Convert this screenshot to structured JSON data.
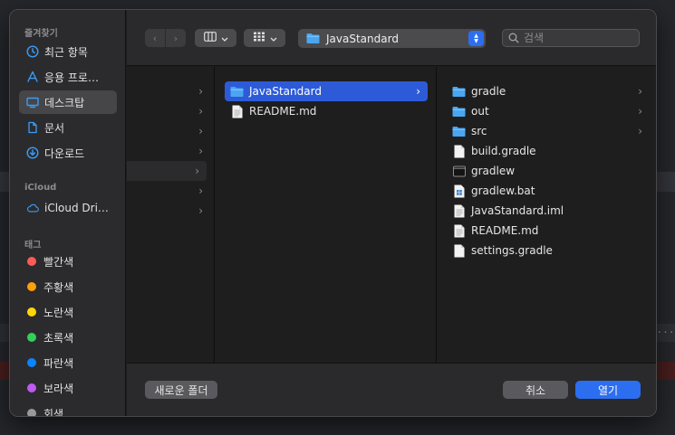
{
  "sidebar": {
    "favorites_header": "즐겨찾기",
    "favorites": [
      {
        "label": "최근 항목",
        "icon": "clock-icon"
      },
      {
        "label": "응용 프로…",
        "icon": "apps-icon"
      },
      {
        "label": "데스크탑",
        "icon": "desktop-icon",
        "selected": true
      },
      {
        "label": "문서",
        "icon": "document-icon"
      },
      {
        "label": "다운로드",
        "icon": "download-icon"
      }
    ],
    "icloud_header": "iCloud",
    "icloud": [
      {
        "label": "iCloud Dri…",
        "icon": "cloud-icon"
      }
    ],
    "tags_header": "태그",
    "tags": [
      {
        "label": "빨간색",
        "color": "#ff5b57"
      },
      {
        "label": "주황색",
        "color": "#ff9f0a"
      },
      {
        "label": "노란색",
        "color": "#ffd60a"
      },
      {
        "label": "초록색",
        "color": "#30d158"
      },
      {
        "label": "파란색",
        "color": "#0a84ff"
      },
      {
        "label": "보라색",
        "color": "#bf5af2"
      },
      {
        "label": "회색",
        "color": "#98989d"
      }
    ]
  },
  "toolbar": {
    "path_label": "JavaStandard",
    "search_placeholder": "검색"
  },
  "columns": {
    "col2": [
      {
        "name": "JavaStandard",
        "type": "folder",
        "selected": true,
        "has_children": true
      },
      {
        "name": "README.md",
        "type": "text-file"
      }
    ],
    "col3": [
      {
        "name": "gradle",
        "type": "folder",
        "has_children": true
      },
      {
        "name": "out",
        "type": "folder",
        "has_children": true
      },
      {
        "name": "src",
        "type": "folder",
        "has_children": true
      },
      {
        "name": "build.gradle",
        "type": "file"
      },
      {
        "name": "gradlew",
        "type": "exec-file"
      },
      {
        "name": "gradlew.bat",
        "type": "bat-file"
      },
      {
        "name": "JavaStandard.iml",
        "type": "text-file"
      },
      {
        "name": "README.md",
        "type": "text-file"
      },
      {
        "name": "settings.gradle",
        "type": "file"
      }
    ]
  },
  "footer": {
    "new_folder": "새로운 폴더",
    "cancel": "취소",
    "open": "열기"
  },
  "colors": {
    "accent": "#2c6ef0",
    "selection": "#2d5bd8",
    "folder": "#4aa6f0"
  }
}
